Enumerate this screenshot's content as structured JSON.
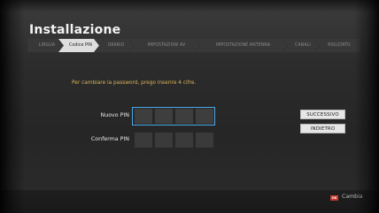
{
  "screen": {
    "title": "Installazione"
  },
  "steps": [
    {
      "label": "LINGUA",
      "state": "done"
    },
    {
      "label": "Codice PIN",
      "state": "active"
    },
    {
      "label": "ORARIO",
      "state": "pending"
    },
    {
      "label": "IMPOSTAZIONI AV",
      "state": "pending"
    },
    {
      "label": "IMPOSTAZIONE ANTENNA",
      "state": "pending"
    },
    {
      "label": "CANALI",
      "state": "pending"
    },
    {
      "label": "RISULTATO",
      "state": "pending"
    }
  ],
  "form": {
    "hint": "Per cambiare la password, prego inserire 4 cifre.",
    "new_pin_label": "Nuovo PIN",
    "confirm_pin_label": "Conferma PIN",
    "pin_length": 4
  },
  "buttons": {
    "next": "SUCCESSIVO",
    "back": "INDIETRO"
  },
  "footer": {
    "ok_key": "OK",
    "action": "Cambia"
  },
  "colors": {
    "accent": "#4aa8e8",
    "hint_text": "#d8b45a",
    "ok_key": "#c0392b",
    "active_step": "#dedede"
  }
}
